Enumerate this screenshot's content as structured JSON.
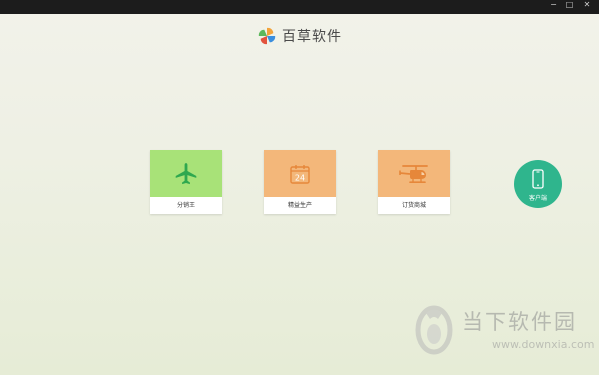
{
  "window": {
    "controls": {
      "minimize": "−",
      "maximize": "□",
      "close": "✕"
    }
  },
  "brand": {
    "name": "百草软件"
  },
  "tiles": [
    {
      "label": "分销王",
      "icon": "airplane-icon",
      "color": "#a8e278"
    },
    {
      "label": "精益生产",
      "icon": "calendar-icon",
      "color": "#f3b77a",
      "icon_text": "24"
    },
    {
      "label": "订货商城",
      "icon": "helicopter-icon",
      "color": "#f3b77a"
    }
  ],
  "client": {
    "label": "客户端",
    "icon": "mobile-phone-icon",
    "color": "#2fb58d"
  },
  "watermark": {
    "name": "当下软件园",
    "url": "www.downxia.com"
  }
}
